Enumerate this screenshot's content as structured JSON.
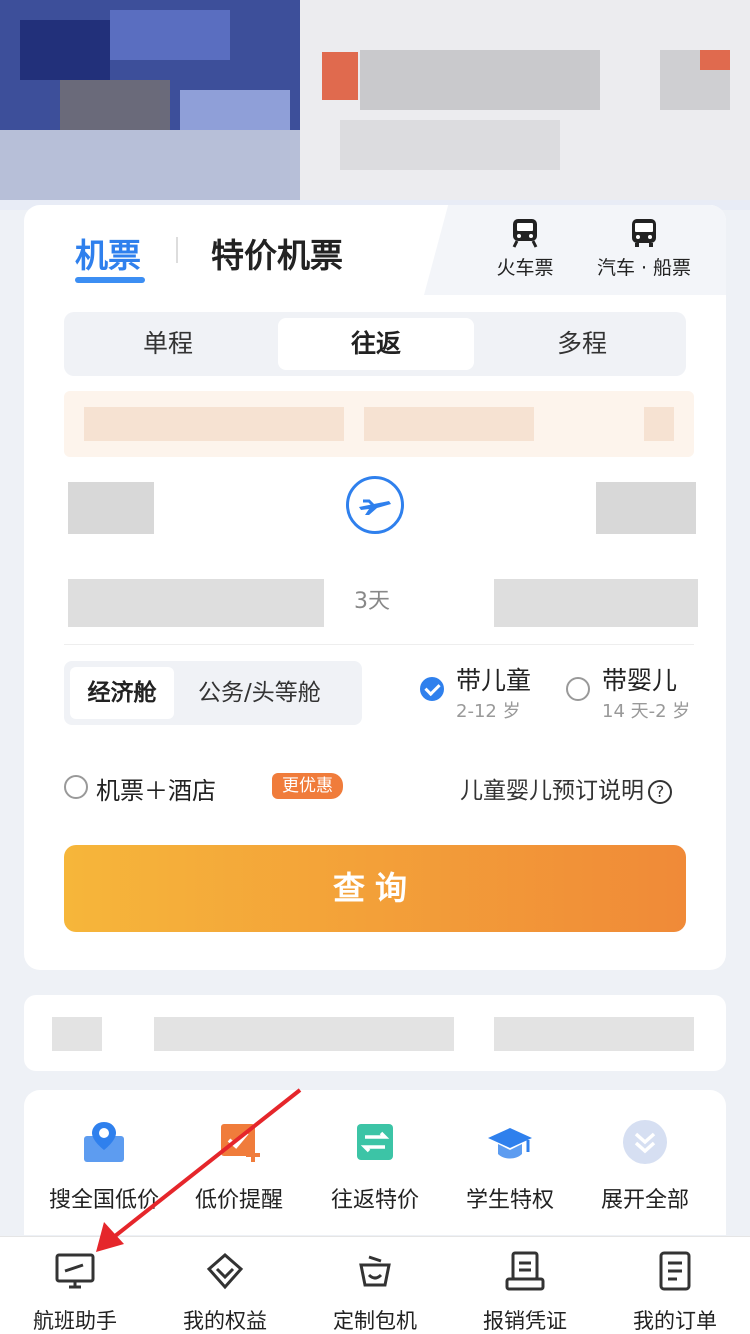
{
  "transport_tabs": {
    "flight": "机票",
    "special_flight": "特价机票",
    "train": "火车票",
    "bus_ship": "汽车 · 船票"
  },
  "trip_types": [
    "单程",
    "往返",
    "多程"
  ],
  "trip_type_selected": "往返",
  "date_range": {
    "days": "3天"
  },
  "cabin": {
    "economy": "经济舱",
    "business_first": "公务/头等舱",
    "selected": "经济舱"
  },
  "passengers": {
    "child": {
      "label": "带儿童",
      "age": "2-12 岁",
      "checked": true
    },
    "infant": {
      "label": "带婴儿",
      "age": "14 天-2 岁",
      "checked": false
    }
  },
  "combo": {
    "label": "机票＋酒店",
    "badge": "更优惠"
  },
  "explain": {
    "label": "儿童婴儿预订说明",
    "icon": "help-icon"
  },
  "search_button": "查询",
  "shortcuts": [
    {
      "label": "搜全国低价",
      "icon": "map-pin-icon"
    },
    {
      "label": "低价提醒",
      "icon": "price-alert-icon"
    },
    {
      "label": "往返特价",
      "icon": "round-trip-icon"
    },
    {
      "label": "学生特权",
      "icon": "graduation-cap-icon"
    },
    {
      "label": "展开全部",
      "icon": "expand-icon"
    }
  ],
  "bottom_nav": [
    {
      "label": "航班助手",
      "icon": "flight-monitor-icon"
    },
    {
      "label": "我的权益",
      "icon": "diamond-icon"
    },
    {
      "label": "定制包机",
      "icon": "custom-charter-icon"
    },
    {
      "label": "报销凭证",
      "icon": "receipt-icon"
    },
    {
      "label": "我的订单",
      "icon": "orders-icon"
    }
  ],
  "colors": {
    "accent": "#2f80ed",
    "button_start": "#f6b63a",
    "button_end": "#f08a38",
    "badge": "#f07c3b"
  }
}
